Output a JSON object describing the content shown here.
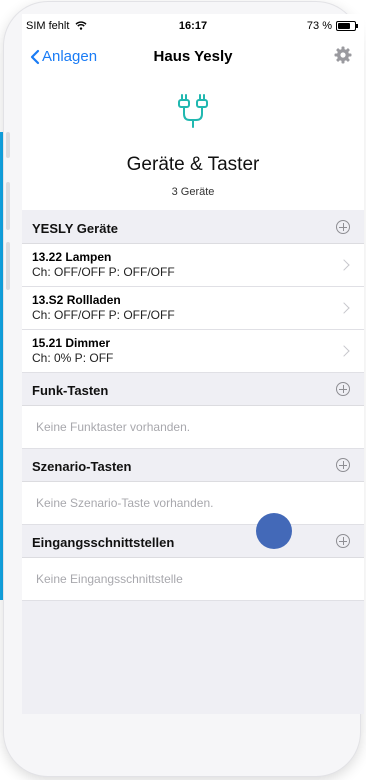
{
  "status_bar": {
    "carrier": "SIM fehlt",
    "time": "16:17",
    "battery": "73 %"
  },
  "nav": {
    "back_label": "Anlagen",
    "title": "Haus Yesly"
  },
  "header": {
    "title": "Geräte & Taster",
    "subtitle": "3 Geräte"
  },
  "sections": {
    "yesly": {
      "title": "YESLY Geräte",
      "devices": [
        {
          "name": "13.22 Lampen",
          "status": "Ch: OFF/OFF  P: OFF/OFF"
        },
        {
          "name": "13.S2 Rollladen",
          "status": "Ch: OFF/OFF  P: OFF/OFF"
        },
        {
          "name": "15.21 Dimmer",
          "status": "Ch: 0%  P: OFF"
        }
      ]
    },
    "funk": {
      "title": "Funk-Tasten",
      "empty": "Keine Funktaster vorhanden."
    },
    "szenario": {
      "title": "Szenario-Tasten",
      "empty": "Keine Szenario-Taste vorhanden."
    },
    "eingang": {
      "title": "Eingangsschnittstellen",
      "empty": "Keine Eingangsschnittstelle"
    }
  },
  "colors": {
    "accent": "#1a7cf5",
    "icon_teal": "#21b8b0",
    "touch_dot": "#4369b8",
    "side_strip": "#12a6e6"
  },
  "icons": [
    "wifi-icon",
    "battery-icon",
    "chevron-left-icon",
    "gear-icon",
    "plug-icon",
    "plus-circle-icon",
    "chevron-right-icon"
  ]
}
